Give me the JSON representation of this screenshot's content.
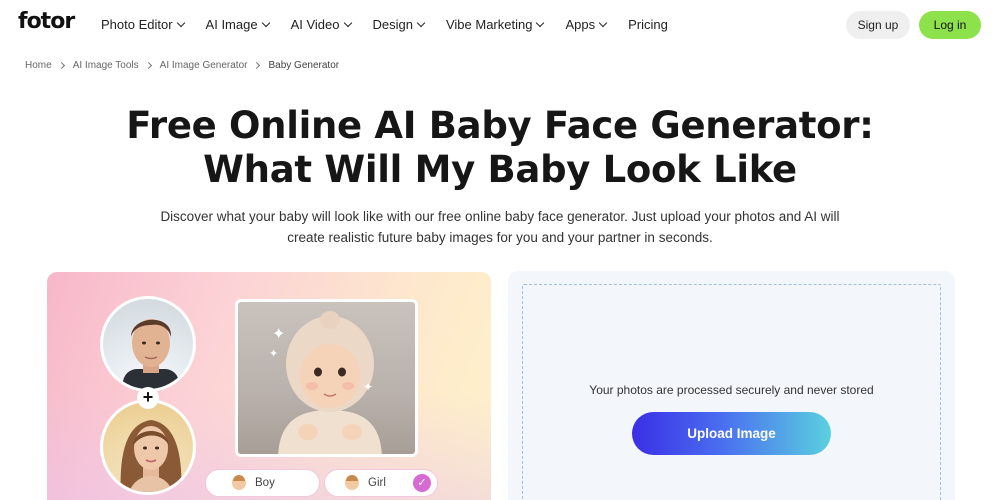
{
  "header": {
    "logo": "fotor",
    "nav": [
      {
        "label": "Photo Editor",
        "has_dropdown": true
      },
      {
        "label": "AI Image",
        "has_dropdown": true
      },
      {
        "label": "AI Video",
        "has_dropdown": true
      },
      {
        "label": "Design",
        "has_dropdown": true
      },
      {
        "label": "Vibe Marketing",
        "has_dropdown": true
      },
      {
        "label": "Apps",
        "has_dropdown": true
      },
      {
        "label": "Pricing",
        "has_dropdown": false
      }
    ],
    "signup_label": "Sign up",
    "login_label": "Log in"
  },
  "breadcrumb": [
    "Home",
    "AI Image Tools",
    "AI Image Generator",
    "Baby Generator"
  ],
  "hero": {
    "title_line1": "Free Online AI Baby Face Generator:",
    "title_line2": "What Will My Baby Look Like",
    "subtitle": "Discover what your baby will look like with our free online baby face generator. Just upload your photos and AI will create realistic future baby images for you and your partner in seconds."
  },
  "demo": {
    "plus": "+",
    "gender_options": [
      {
        "label": "Boy",
        "selected": false
      },
      {
        "label": "Girl",
        "selected": true
      }
    ],
    "check": "✓"
  },
  "upload": {
    "secure_text": "Your photos are processed securely and never stored",
    "button_label": "Upload Image"
  },
  "colors": {
    "login_green": "#8de24c",
    "upload_gradient_start": "#3a2fe6",
    "upload_gradient_end": "#5ad0df",
    "girl_check": "#d56bd3"
  }
}
